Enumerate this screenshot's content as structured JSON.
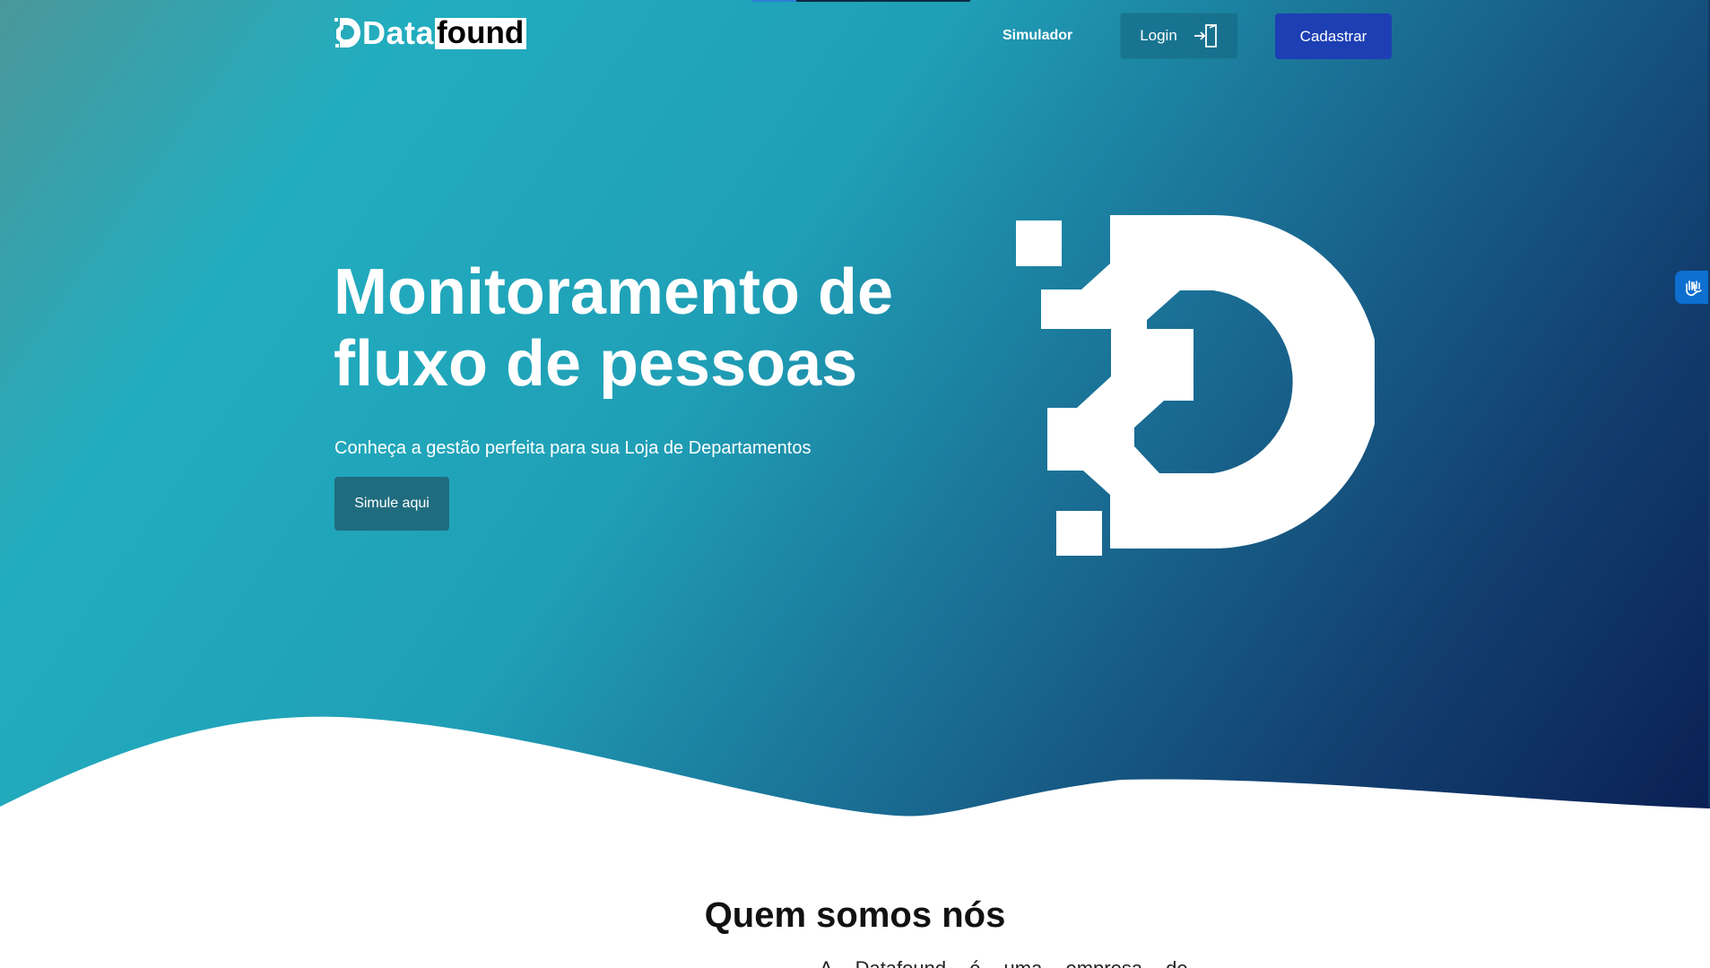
{
  "header": {
    "logo": {
      "part1": "Data",
      "part2": "found"
    },
    "nav": {
      "simulator_label": "Simulador"
    },
    "login_label": "Login",
    "register_label": "Cadastrar"
  },
  "hero": {
    "title_line1": "Monitoramento de",
    "title_line2": "fluxo de pessoas",
    "subtitle": "Conheça a gestão perfeita para sua Loja de Departamentos",
    "cta_label": "Simule aqui"
  },
  "about": {
    "title": "Quem somos nós",
    "text_partial": "A Datafound é uma empresa de"
  },
  "icons": {
    "logo_mark": "datafound-d-icon",
    "login": "login-door-icon",
    "accessibility": "vlibras-hands-icon"
  },
  "colors": {
    "register_button": "#1d3fb3",
    "cta_button": "#206c7f",
    "accessibility_button": "#0d6fd0",
    "gradient_start": "#22adbf",
    "gradient_end": "#0a1f54"
  }
}
